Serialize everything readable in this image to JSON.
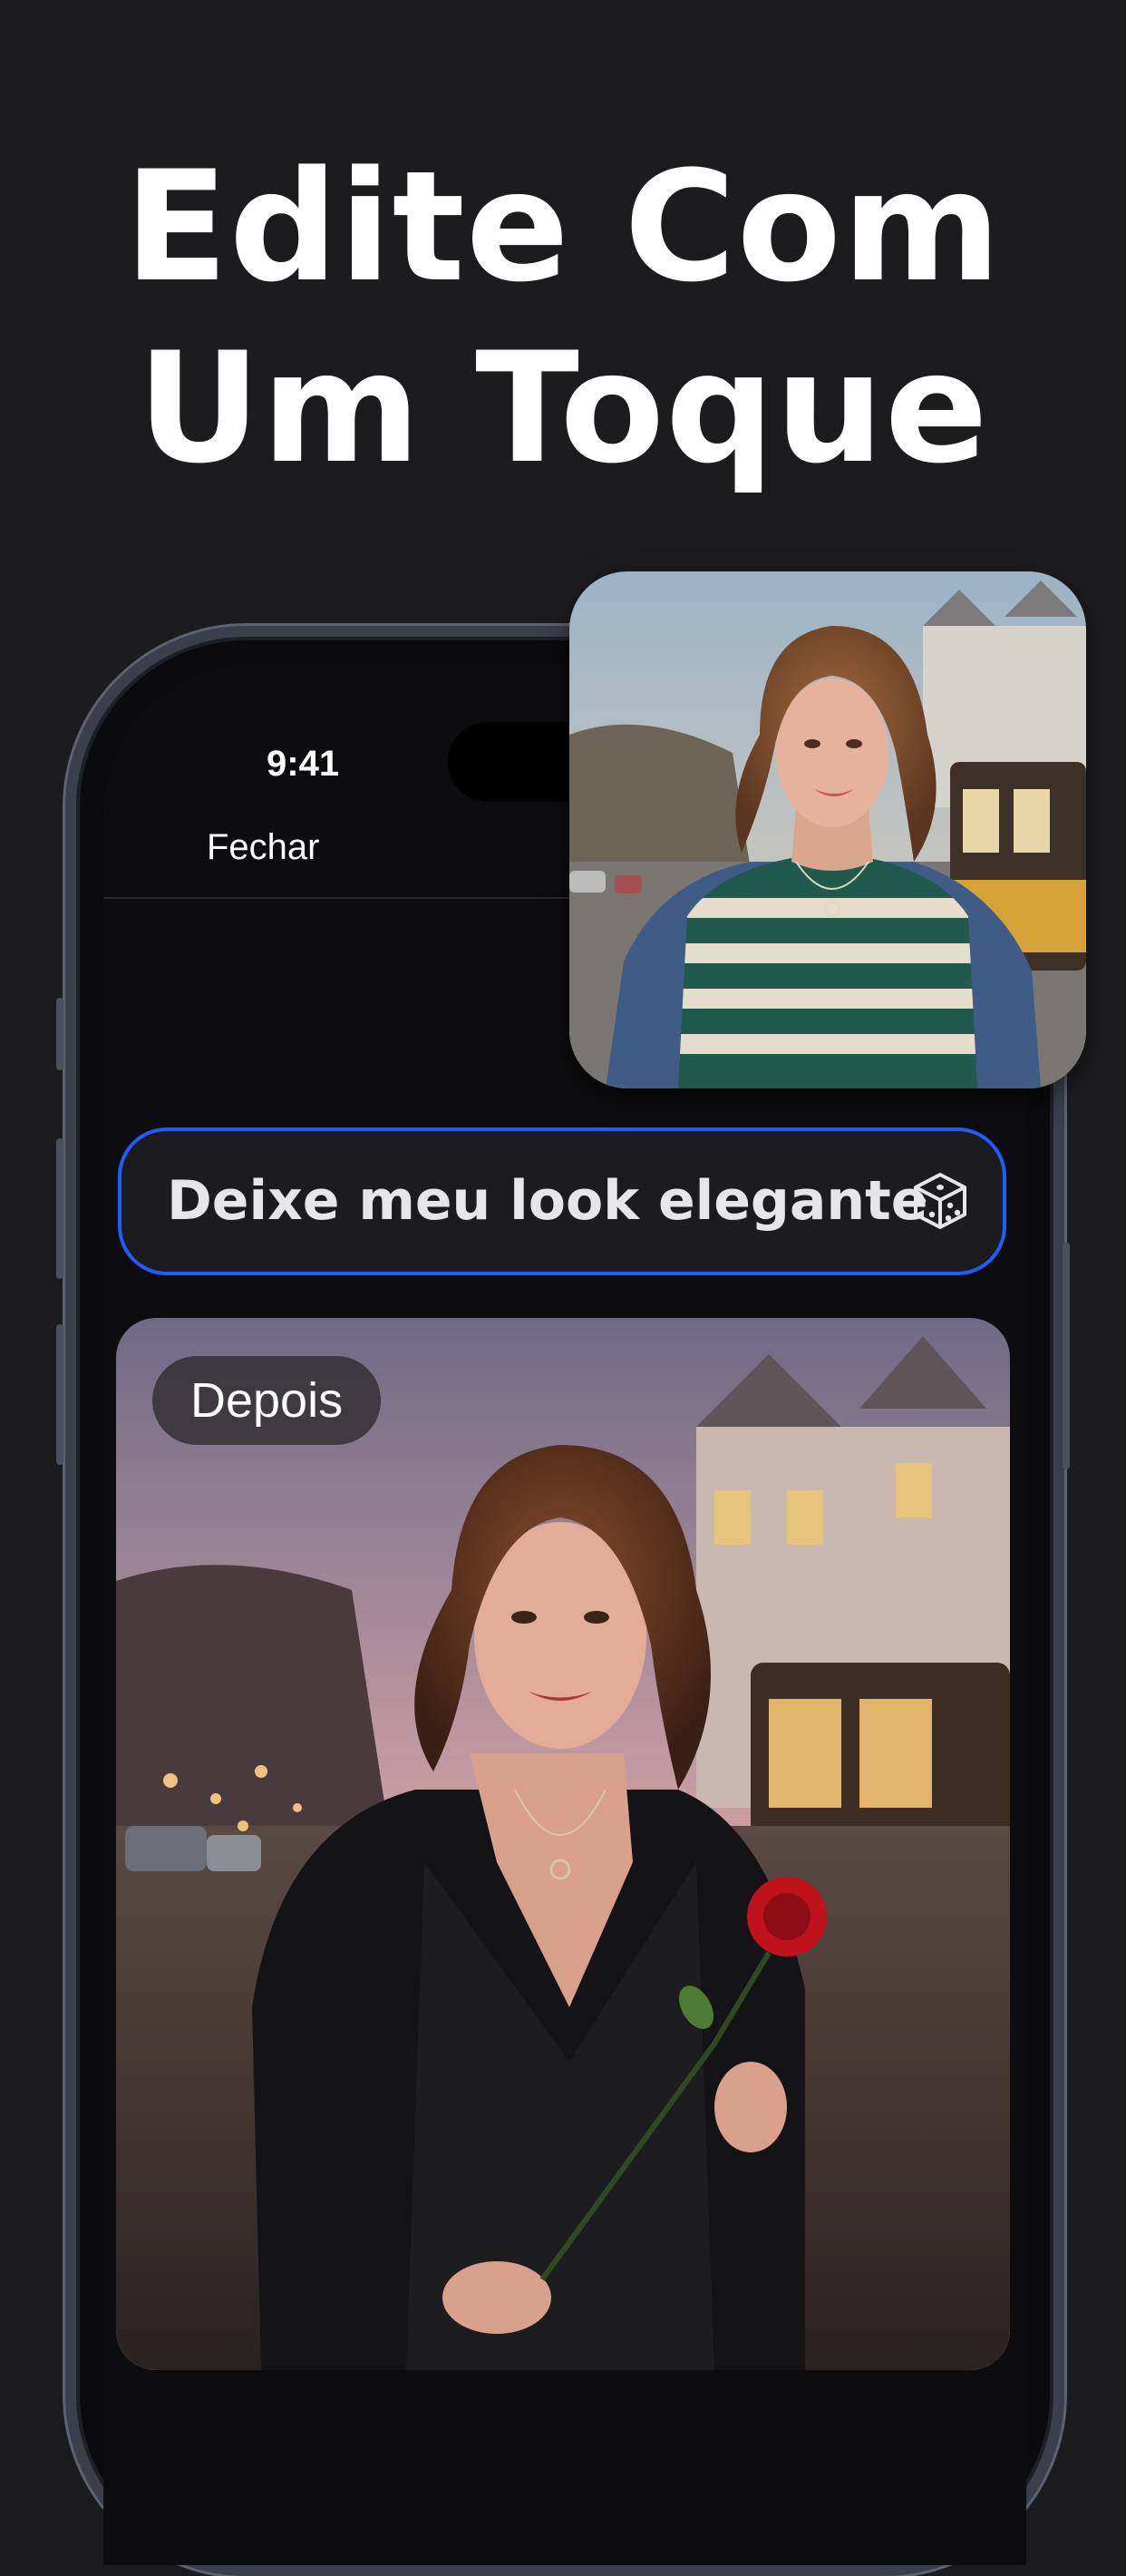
{
  "headline": {
    "line1": "Edite Com",
    "line2": "Um Toque"
  },
  "status_bar": {
    "time": "9:41"
  },
  "header": {
    "close_label": "Fechar"
  },
  "prompt": {
    "text": "Deixe meu look elegante",
    "icon": "dice-icon"
  },
  "result_image": {
    "badge_label": "Depois",
    "description": "woman in black dress holding red rose on street with cable car at dusk"
  },
  "before_image": {
    "description": "woman in striped green sweater and denim jacket on street with cable car"
  },
  "colors": {
    "background": "#1c1c1e",
    "accent_border": "#1f5bff",
    "text": "#ffffff"
  }
}
